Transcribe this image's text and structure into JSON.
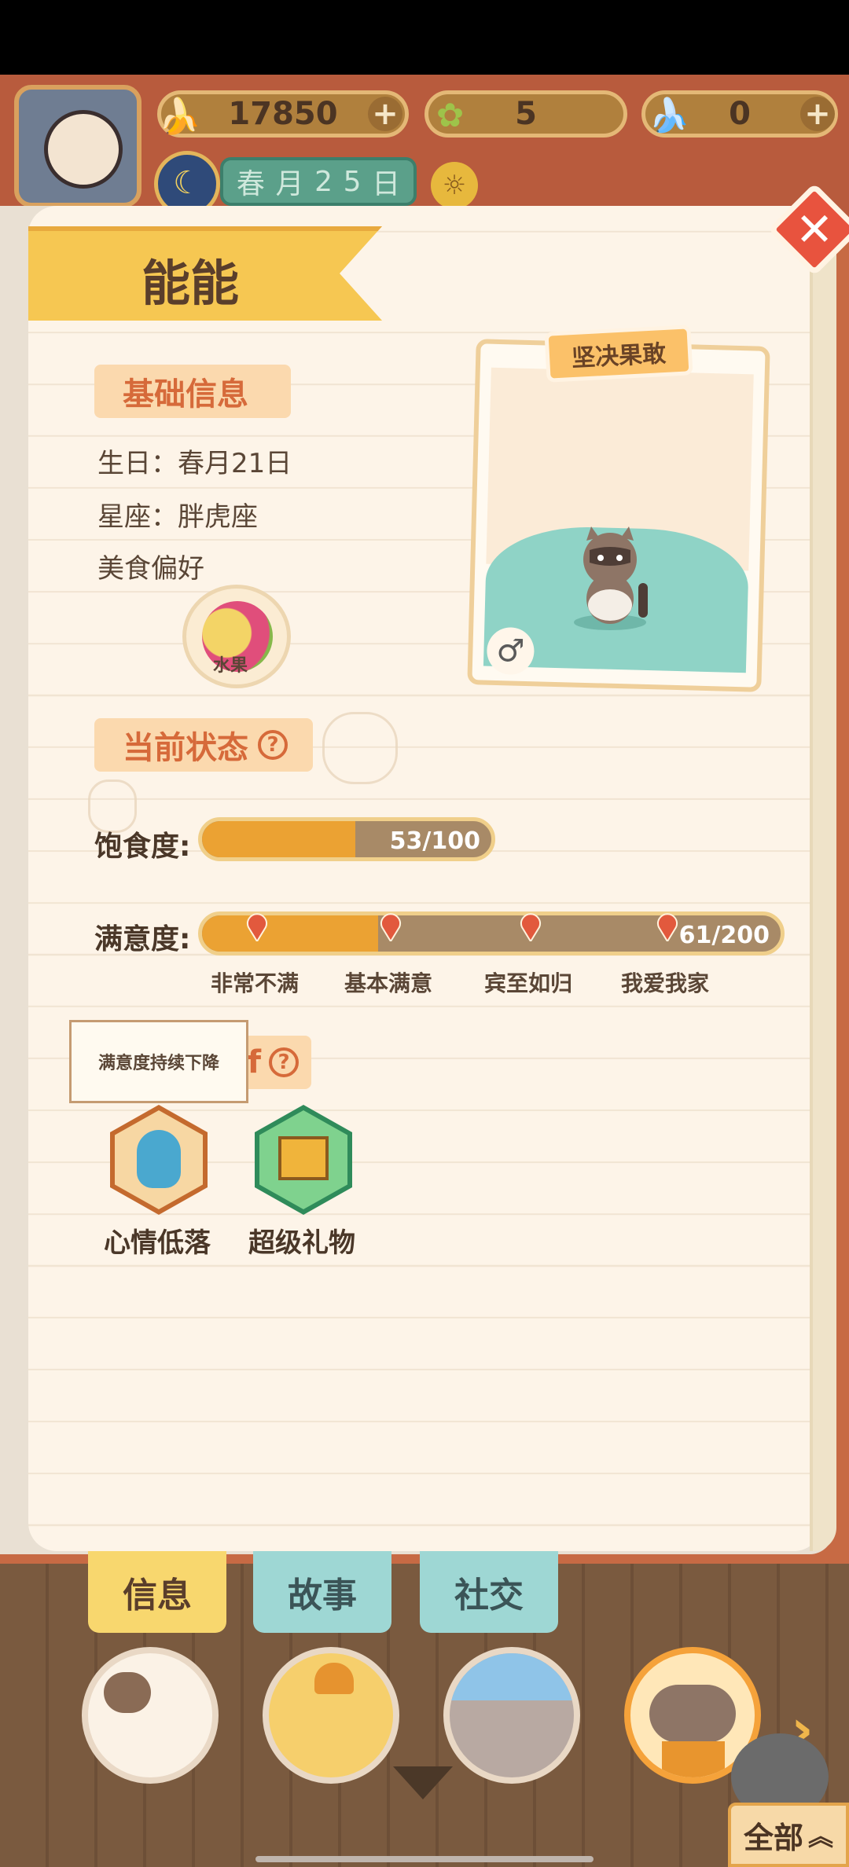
{
  "hud": {
    "banana_count": "17850",
    "clover_count": "5",
    "blue_banana_count": "0",
    "date": [
      "春",
      "月",
      "2",
      "5",
      "日"
    ]
  },
  "character": {
    "name": "能能",
    "personality_tag": "坚决果敢",
    "gender_symbol": "♂"
  },
  "basic_info": {
    "title": "基础信息",
    "birthday": "生日：春月21日",
    "sign": "星座：胖虎座",
    "food_pref_label": "美食偏好",
    "food": "水果"
  },
  "status": {
    "title": "当前状态",
    "help": "?",
    "satiety_label": "饱食度:",
    "satiety_text": "53/100",
    "satiety_fraction": 0.53,
    "satisfaction_label": "满意度:",
    "satisfaction_text": "61/200",
    "satisfaction_fraction": 0.305,
    "milestones": [
      "非常不满",
      "基本满意",
      "宾至如归",
      "我爱我家"
    ]
  },
  "buffs": {
    "title_fragment": "f",
    "help": "?",
    "tooltip": "满意度持续下降",
    "items": [
      "心情低落",
      "超级礼物"
    ]
  },
  "tabs": [
    "信息",
    "故事",
    "社交"
  ],
  "all_button": "全部",
  "colors": {
    "accent": "#eba233",
    "tag_text": "#d66a3a",
    "close": "#e8533e"
  }
}
